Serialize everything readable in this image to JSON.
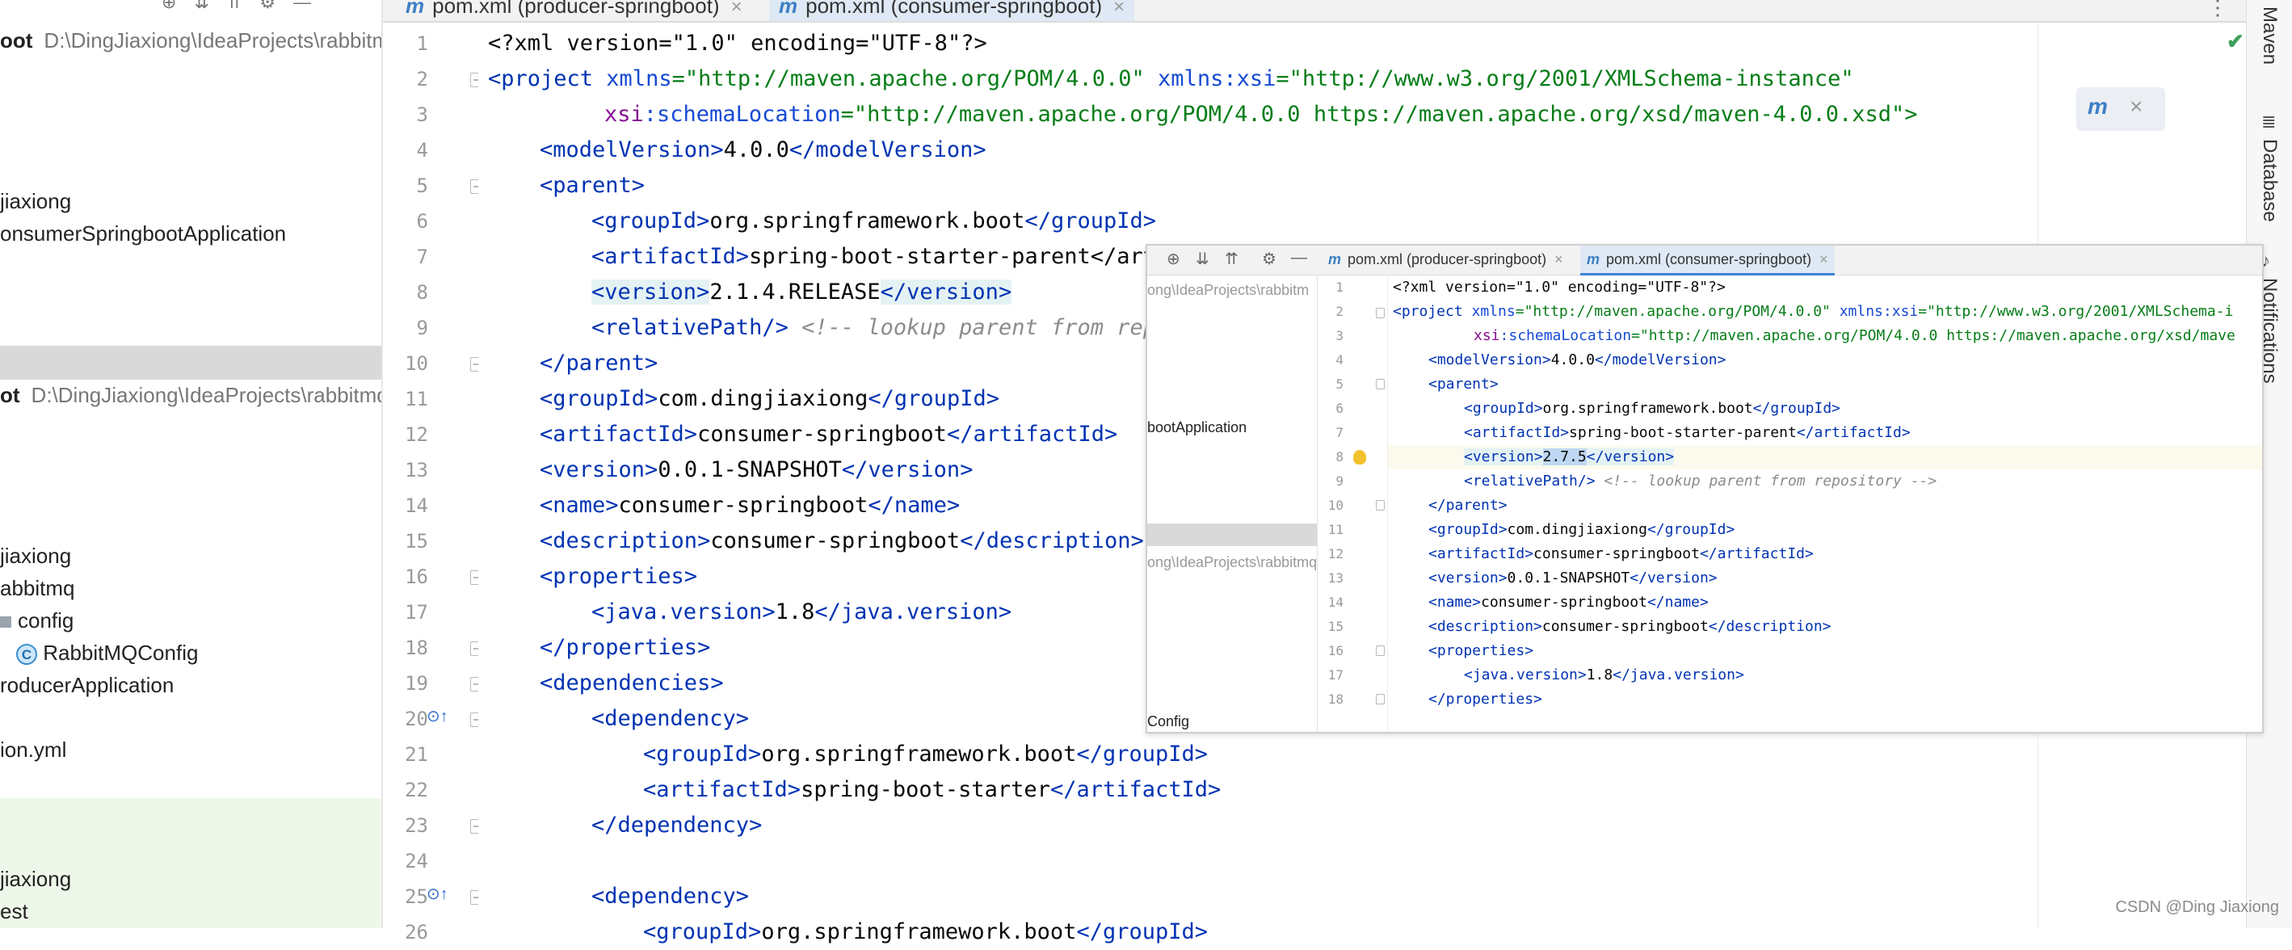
{
  "project_panel": {
    "rows": [
      {
        "text": "oot",
        "path": "D:\\DingJiaxiong\\IdeaProjects\\rabbitm"
      },
      {
        "text": "jiaxiong"
      },
      {
        "text": "onsumerSpringbootApplication"
      },
      {
        "text": "ot",
        "path": "D:\\DingJiaxiong\\IdeaProjects\\rabbitmq"
      },
      {
        "text": "jiaxiong"
      },
      {
        "text": "abbitmq"
      },
      {
        "text": "config"
      },
      {
        "text": "RabbitMQConfig"
      },
      {
        "text": "roducerApplication"
      },
      {
        "text": "ion.yml"
      },
      {
        "text": "jiaxiong"
      },
      {
        "text": "est"
      }
    ],
    "class_icon_letter": "C"
  },
  "tabs": [
    {
      "label": "pom.xml (producer-springboot)",
      "icon": "m"
    },
    {
      "label": "pom.xml (consumer-springboot)",
      "icon": "m",
      "active": true
    }
  ],
  "editor": {
    "line_numbers": [
      "1",
      "2",
      "3",
      "4",
      "5",
      "6",
      "7",
      "8",
      "9",
      "10",
      "11",
      "12",
      "13",
      "14",
      "15",
      "16",
      "17",
      "18",
      "19",
      "20",
      "21",
      "22",
      "23",
      "24",
      "25",
      "26"
    ],
    "code": {
      "l1_decl": "<?xml version=\"1.0\" encoding=\"UTF-8\"?>",
      "l2_open": "<project",
      "l2_attr1": " xmlns",
      "l2_val1": "=\"http://maven.apache.org/POM/4.0.0\"",
      "l2_ns": " xmlns:xsi",
      "l2_val2": "=\"http://www.w3.org/2001/XMLSchema-instance\"",
      "l3_ns": "xsi",
      "l3_attr": ":schemaLocation",
      "l3_val": "=\"http://maven.apache.org/POM/4.0.0 https://maven.apache.org/xsd/maven-4.0.0.xsd\">",
      "model_version": "4.0.0",
      "parent_group": "org.springframework.boot",
      "parent_artifact": "spring-boot-starter-parent",
      "parent_artifact_cut": "spring-boot-starter-parent</art",
      "parent_version": "2.1.4.RELEASE",
      "relpath_comment": "<!-- lookup parent from rep",
      "group_id": "com.dingjiaxiong",
      "artifact_id": "consumer-springboot",
      "version": "0.0.1-SNAPSHOT",
      "name": "consumer-springboot",
      "description": "consumer-springboot",
      "java_version": "1.8",
      "dep1_group": "org.springframework.boot",
      "dep1_artifact": "spring-boot-starter",
      "dep2_group_cut": "org.springframework.boot"
    }
  },
  "inset": {
    "tabs": [
      {
        "label": "pom.xml (producer-springboot)"
      },
      {
        "label": "pom.xml (consumer-springboot)",
        "active": true
      }
    ],
    "panel_rows": [
      {
        "text": "ong\\IdeaProjects\\rabbitm"
      },
      {
        "text": "bootApplication"
      },
      {
        "text": "ong\\IdeaProjects\\rabbitmq"
      },
      {
        "text": "Config"
      }
    ],
    "line_numbers": [
      "1",
      "2",
      "3",
      "4",
      "5",
      "6",
      "7",
      "8",
      "9",
      "10",
      "11",
      "12",
      "13",
      "14",
      "15",
      "16",
      "17",
      "18"
    ],
    "code": {
      "l2_val2_cut": "=\"http://www.w3.org/2001/XMLSchema-i",
      "l3_val_cut": "=\"http://maven.apache.org/POM/4.0.0 https://maven.apache.org/xsd/mave",
      "relpath_comment": "<!-- lookup parent from repository -->",
      "parent_version": "2.7.5"
    }
  },
  "right_strip": {
    "maven_label": "Maven",
    "database_label": "Database",
    "notifications_label": "Notifications"
  },
  "watermark": "CSDN @Ding Jiaxiong",
  "colors": {
    "tag": "#0033b3",
    "attr": "#174ad4",
    "namespace": "#871094",
    "value": "#067d17",
    "comment": "#8c8c8c",
    "accent": "#4083d6"
  }
}
